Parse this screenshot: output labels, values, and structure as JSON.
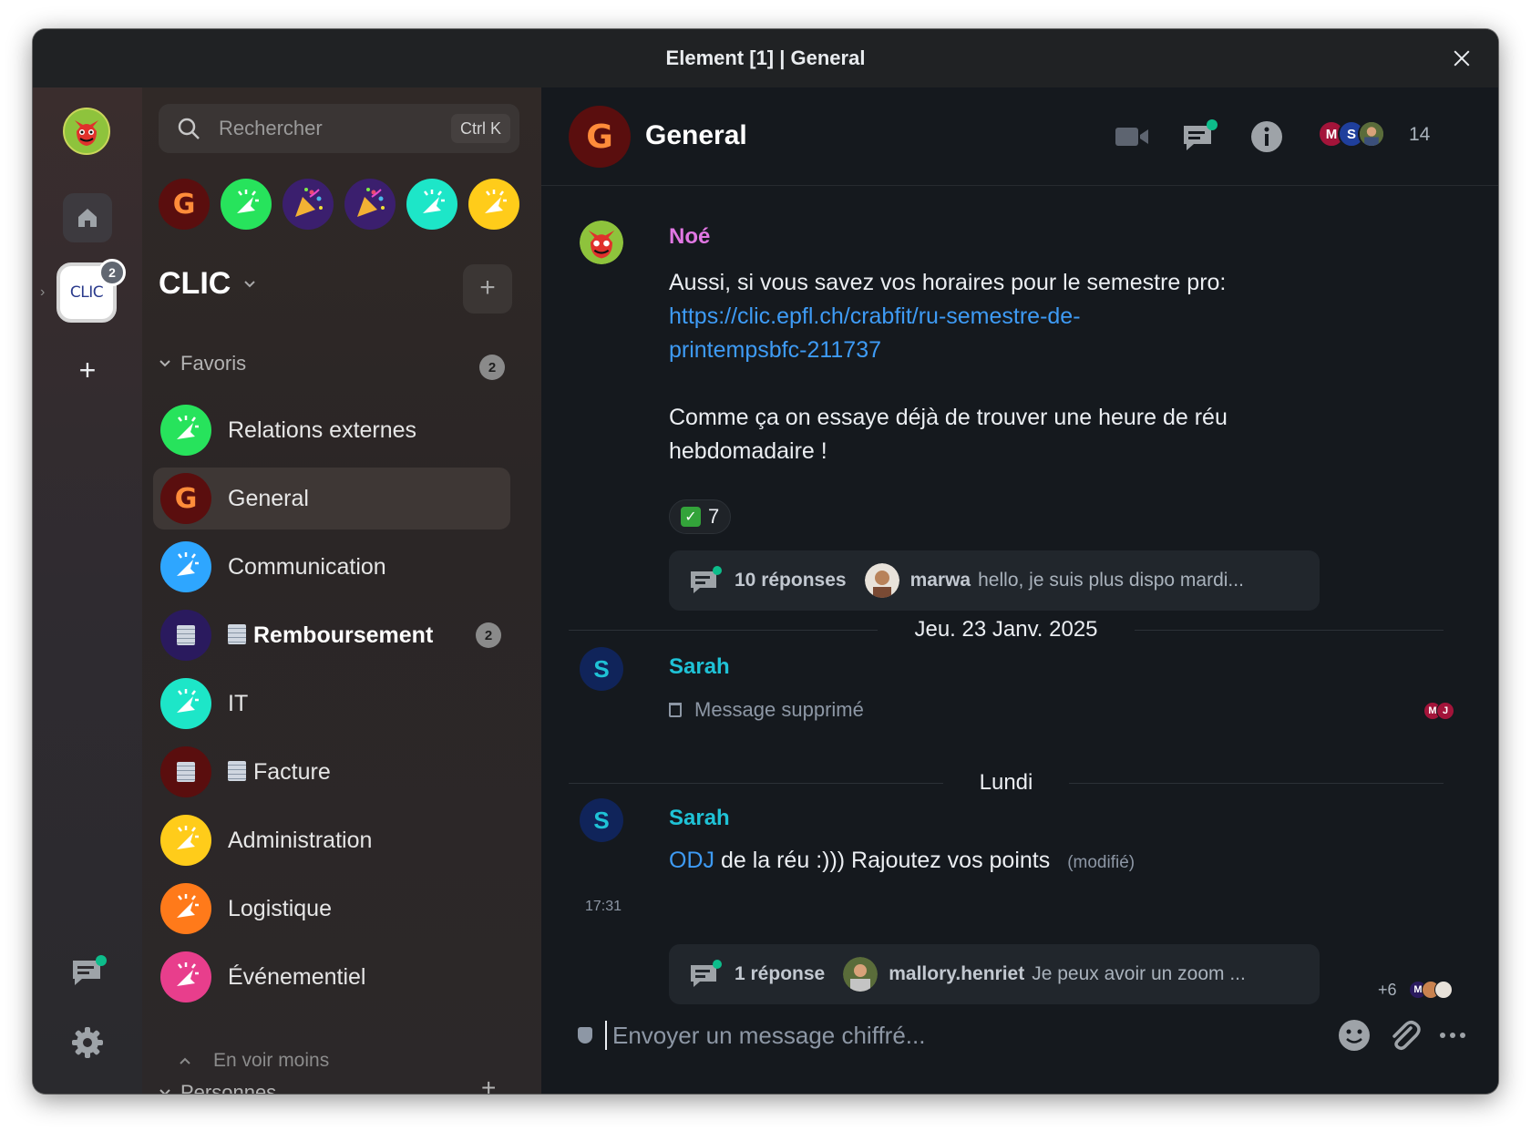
{
  "window": {
    "title": "Element [1] | General"
  },
  "spaces": {
    "clic_logo": "CLIC",
    "clic_badge": "2"
  },
  "search": {
    "placeholder": "Rechercher",
    "shortcut": "Ctrl K"
  },
  "recent_rooms": [
    {
      "name": "General",
      "letter": "G",
      "color": "#5a0e0e"
    },
    {
      "name": "Relations externes",
      "color": "#27e35c"
    },
    {
      "name": "party",
      "color": "#3b1f6e"
    },
    {
      "name": "party-2",
      "color": "#3b1f6e"
    },
    {
      "name": "IT",
      "color": "#1de6c8"
    },
    {
      "name": "Administration",
      "color": "#ffcc1a"
    }
  ],
  "space": {
    "title": "CLIC"
  },
  "sections": {
    "favorites": {
      "label": "Favoris",
      "badge": "2"
    },
    "people": {
      "label": "Personnes"
    },
    "see_less": "En voir moins"
  },
  "rooms": [
    {
      "name": "Relations externes",
      "color": "#27e35c",
      "active": false,
      "bold": false
    },
    {
      "name": "General",
      "color": "#5a0e0e",
      "active": true,
      "bold": false,
      "letter": "G"
    },
    {
      "name": "Communication",
      "color": "#2ea6ff",
      "active": false,
      "bold": false
    },
    {
      "name": "Remboursement",
      "color": "#2a1a5e",
      "active": false,
      "bold": true,
      "badge": "2"
    },
    {
      "name": "IT",
      "color": "#1de6c8",
      "active": false,
      "bold": false
    },
    {
      "name": "Facture",
      "color": "#5a0e0e",
      "active": false,
      "bold": false
    },
    {
      "name": "Administration",
      "color": "#ffcc1a",
      "active": false,
      "bold": false
    },
    {
      "name": "Logistique",
      "color": "#ff7a1a",
      "active": false,
      "bold": false
    },
    {
      "name": "Événementiel",
      "color": "#e83e8c",
      "active": false,
      "bold": false
    }
  ],
  "header": {
    "room_name": "General",
    "room_letter": "G",
    "members": [
      {
        "letter": "M",
        "color": "#a3143a"
      },
      {
        "letter": "S",
        "color": "#1f3f9c"
      }
    ],
    "member_count": "14"
  },
  "messages": {
    "noe": {
      "sender": "Noé",
      "line1": "Aussi, si vous savez vos horaires pour le semestre pro:",
      "link_line1": "https://clic.epfl.ch/crabfit/ru-semestre-de-",
      "link_line2": "printempsbfc-211737",
      "para2_line1": "Comme ça on essaye déjà de trouver une heure de réu",
      "para2_line2": "hebdomadaire !",
      "reaction_count": "7",
      "thread": {
        "count": "10 réponses",
        "author": "marwa",
        "snippet": "hello, je suis plus dispo mardi..."
      }
    },
    "date1": "Jeu. 23 Janv. 2025",
    "sarah1": {
      "sender": "Sarah",
      "avatar_letter": "S",
      "deleted_text": "Message supprimé",
      "read_receipts": [
        "M",
        "J"
      ]
    },
    "date2": "Lundi",
    "sarah2": {
      "sender": "Sarah",
      "avatar_letter": "S",
      "timestamp": "17:31",
      "link_text": "ODJ",
      "text": "de la réu :))) Rajoutez vos points",
      "edited": "(modifié)",
      "thread": {
        "count": "1 réponse",
        "author": "mallory.henriet",
        "snippet": "Je peux avoir un zoom ..."
      },
      "read_more": "+6",
      "read_receipt_letter": "M"
    }
  },
  "composer": {
    "placeholder": "Envoyer un message chiffré..."
  },
  "colors": {
    "accent_green": "#0dbd8b",
    "sender_noe": "#e177e3",
    "sender_sarah": "#1fc2d6",
    "link": "#3e9bf5"
  }
}
